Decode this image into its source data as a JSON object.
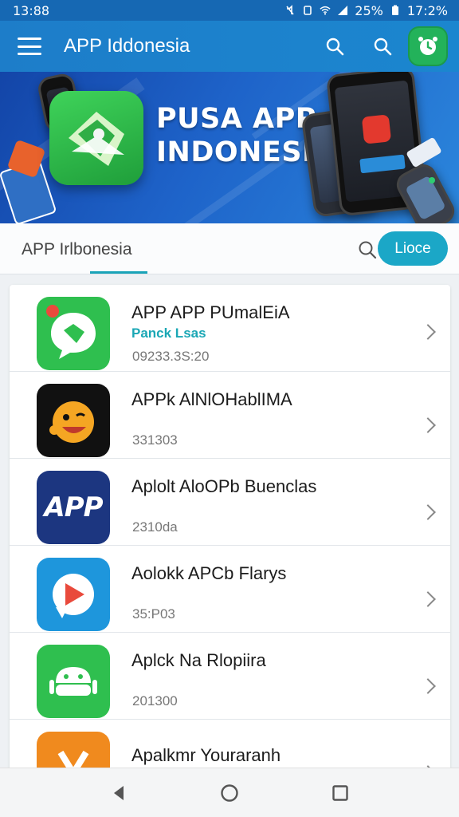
{
  "status_bar": {
    "time": "13:88",
    "battery_text": "25%",
    "clock_right": "17:2%"
  },
  "app_bar": {
    "title": "APP Iddonesia"
  },
  "banner": {
    "title_line1": "PUSA APP",
    "title_line2": "INDONESIA",
    "slide_count": 4
  },
  "tab_row": {
    "tab_label": "APP Irlbonesia",
    "pill_label": "Lioce"
  },
  "apps": [
    {
      "title": "APP APP PUmalEiA",
      "subtitle": "Panck Lsas",
      "meta": "09233.3S:20",
      "icon": "chat-bubble-icon",
      "color": "#2fbf4f"
    },
    {
      "title": "APPk AlNlOHablIMA",
      "subtitle": "",
      "meta": "331303",
      "icon": "emoji-face-icon",
      "color": "#111111"
    },
    {
      "title": "Aplolt AloOPb Buenclas",
      "subtitle": "",
      "meta": "2310da",
      "icon": "app-text-icon",
      "color": "#1c3680"
    },
    {
      "title": "Aolokk APCb Flarys",
      "subtitle": "",
      "meta": "35:P03",
      "icon": "play-bubble-icon",
      "color": "#1e96dc"
    },
    {
      "title": "Aplck Na Rlopiira",
      "subtitle": "",
      "meta": "201300",
      "icon": "android-robot-icon",
      "color": "#2fbf4f"
    },
    {
      "title": "Apalkmr Youraranh",
      "subtitle": "",
      "meta": "",
      "icon": "orange-app-icon",
      "color": "#f08a1e"
    }
  ],
  "colors": {
    "primary": "#1d7dc9",
    "accent": "#1ba7c7",
    "teal_text": "#1aa7b5"
  }
}
